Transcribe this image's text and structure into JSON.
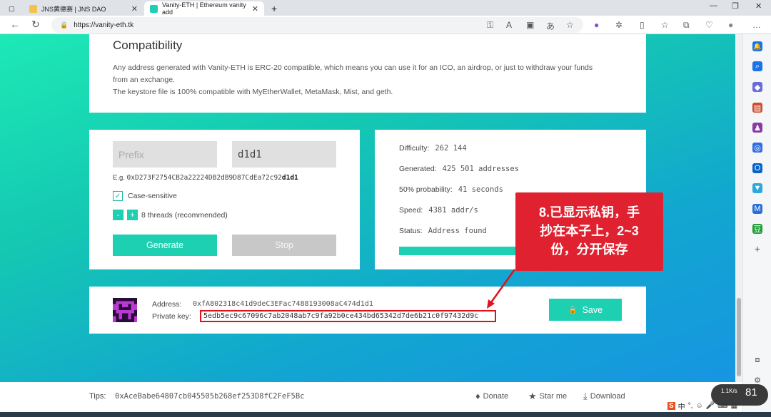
{
  "browser": {
    "tabs": [
      {
        "title": "JNS黄德赛 | JNS DAO",
        "active": false
      },
      {
        "title": "Vanity-ETH | Ethereum vanity add",
        "active": true
      }
    ],
    "new_tab": "+",
    "url": "https://vanity-eth.tk"
  },
  "compat": {
    "title": "Compatibility",
    "line1": "Any address generated with Vanity-ETH is ERC-20 compatible, which means you can use it for an ICO, an airdrop, or just to withdraw your funds",
    "line2": "from an exchange.",
    "line3": "The keystore file is 100% compatible with MyEtherWallet, MetaMask, Mist, and geth."
  },
  "input": {
    "prefix_placeholder": "Prefix",
    "suffix_value": "d1d1",
    "example_prefix": "E.g. ",
    "example_addr": "0xD273F2754CB2a22224DB2dB9D87CdEa72c92",
    "example_suffix": "d1d1",
    "case_label": "Case-sensitive",
    "minus": "-",
    "plus": "+",
    "threads_label": "8 threads (recommended)",
    "generate": "Generate",
    "stop": "Stop"
  },
  "stats": {
    "difficulty_label": "Difficulty:",
    "difficulty": "262 144",
    "generated_label": "Generated:",
    "generated": "425 501 addresses",
    "prob_label": "50% probability:",
    "prob": "41 seconds",
    "speed_label": "Speed:",
    "speed": "4381 addr/s",
    "status_label": "Status:",
    "status": "Address found",
    "progress_fraction": 1.0
  },
  "result": {
    "address_label": "Address:",
    "address": "0xfA802318c41d9deC3EFac7488193008aC474d1d1",
    "pk_label": "Private key:",
    "private_key": "5edb5ec9c67096c7ab2048ab7c9fa92b0ce434bd65342d7de6b21c0f97432d9c",
    "save": "Save"
  },
  "callout": {
    "line1": "8.已显示私钥，手",
    "line2": "抄在本子上，2~3",
    "line3": "份，分开保存"
  },
  "footer": {
    "tips_label": "Tips:",
    "tips_addr": "0xAceBabe64807cb045505b268ef253D8fC2FeF5Bc",
    "donate": "Donate",
    "star": "Star me",
    "download": "Download"
  },
  "system": {
    "net": "1.1K/s",
    "battery": "81"
  },
  "colors": {
    "accent": "#1dd0b1",
    "callout": "#e02230"
  }
}
